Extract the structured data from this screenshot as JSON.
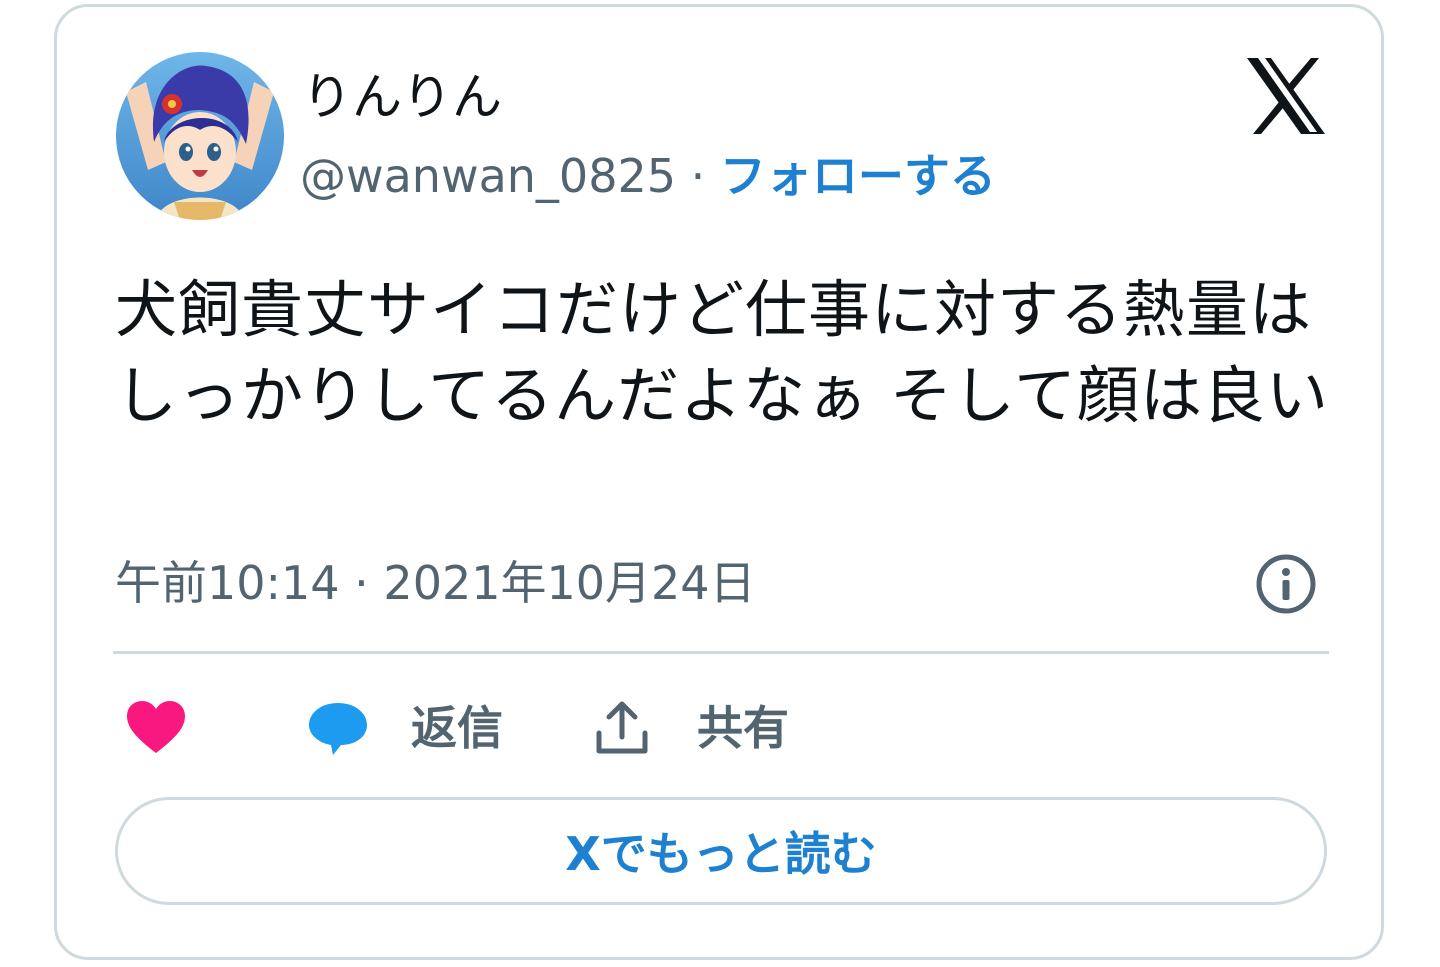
{
  "author": {
    "display_name": "りんりん",
    "handle": "@wanwan_0825",
    "separator": " · ",
    "follow_label": "フォローする"
  },
  "tweet": {
    "text": "犬飼貴丈サイコだけど仕事に対する熱量はしっかりしてるんだよなぁ そして顔は良い",
    "timestamp": "午前10:14 · 2021年10月24日"
  },
  "actions": {
    "like_label": "",
    "reply_label": "返信",
    "share_label": "共有"
  },
  "read_more_label": "Xでもっと読む",
  "colors": {
    "accent": "#1d80d0",
    "like": "#f91880",
    "reply": "#1d9bf0",
    "secondary_text": "#536471",
    "border": "#cfd9de"
  },
  "icons": {
    "brand": "x-logo-icon",
    "info": "info-icon",
    "like": "heart-icon",
    "reply": "speech-bubble-icon",
    "share": "share-upload-icon"
  }
}
